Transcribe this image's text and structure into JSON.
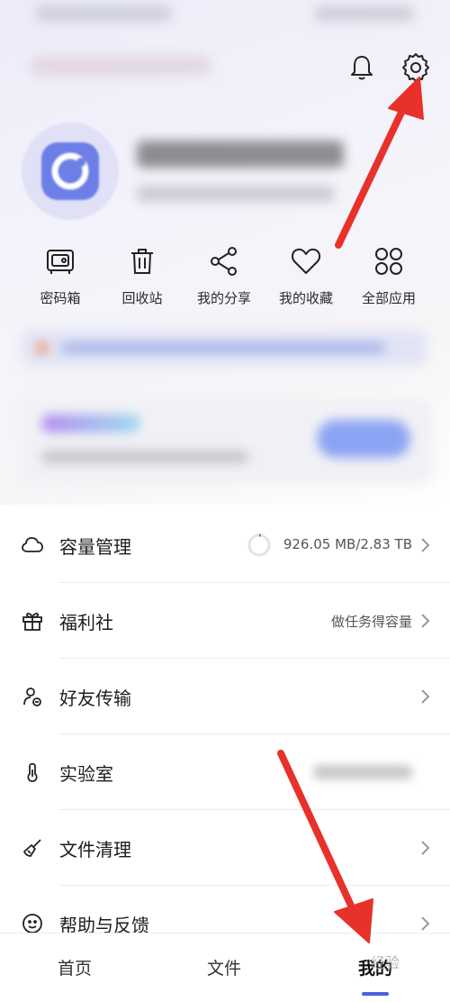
{
  "quick_actions": [
    {
      "label": "密码箱",
      "icon": "safe-icon"
    },
    {
      "label": "回收站",
      "icon": "trash-icon"
    },
    {
      "label": "我的分享",
      "icon": "share-icon"
    },
    {
      "label": "我的收藏",
      "icon": "heart-icon"
    },
    {
      "label": "全部应用",
      "icon": "all-apps-icon"
    }
  ],
  "menu": {
    "storage": {
      "label": "容量管理",
      "value": "926.05 MB/2.83 TB",
      "progress": 0.0003,
      "icon": "cloud-icon"
    },
    "welfare": {
      "label": "福利社",
      "value": "做任务得容量",
      "icon": "gift-icon"
    },
    "friend_transfer": {
      "label": "好友传输",
      "icon": "friend-transfer-icon"
    },
    "lab": {
      "label": "实验室",
      "icon": "thermometer-icon"
    },
    "cleanup": {
      "label": "文件清理",
      "icon": "broom-icon"
    },
    "help": {
      "label": "帮助与反馈",
      "icon": "smile-icon"
    }
  },
  "tabs": [
    {
      "label": "首页"
    },
    {
      "label": "文件"
    },
    {
      "label": "我的",
      "active": true
    }
  ],
  "watermark": "经验",
  "colors": {
    "accent": "#4a5fe0",
    "arrow": "#e8312a"
  }
}
